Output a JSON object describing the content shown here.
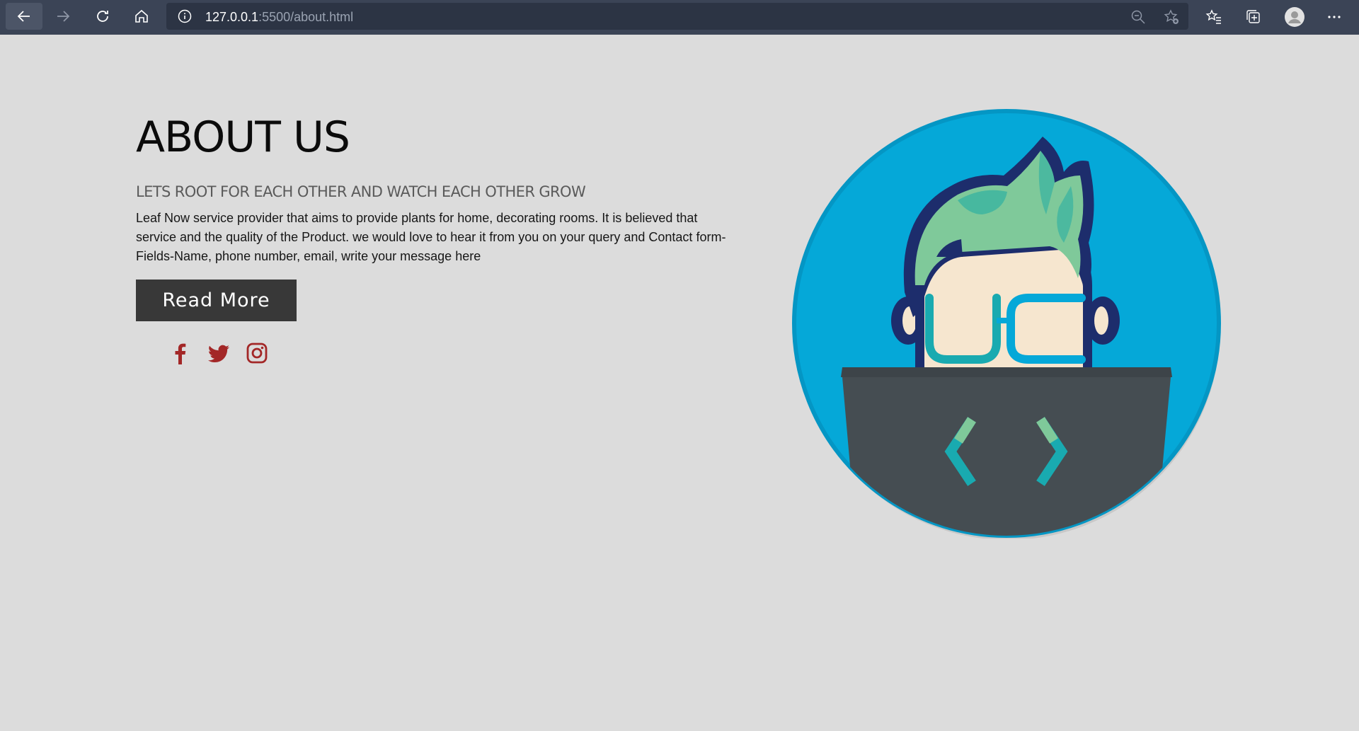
{
  "browser": {
    "url_host": "127.0.0.1",
    "url_rest": ":5500/about.html"
  },
  "about": {
    "title": "ABOUT US",
    "subtitle": "LETS ROOT FOR EACH OTHER AND WATCH EACH OTHER GROW",
    "description": "Leaf Now service provider that aims to provide plants for home, decorating rooms. It is believed that service and the quality of the Product. we would love to hear it from you on your query and Contact form-Fields-Name, phone number, email, write your message here",
    "read_more_label": "Read More"
  },
  "social": [
    {
      "icon": "facebook-icon"
    },
    {
      "icon": "twitter-icon"
    },
    {
      "icon": "instagram-icon"
    }
  ],
  "colors": {
    "background": "#dcdcdc",
    "button": "#383838",
    "social_icon": "#a32727",
    "chrome": "#3b4456",
    "circle": "#05a8d8"
  }
}
